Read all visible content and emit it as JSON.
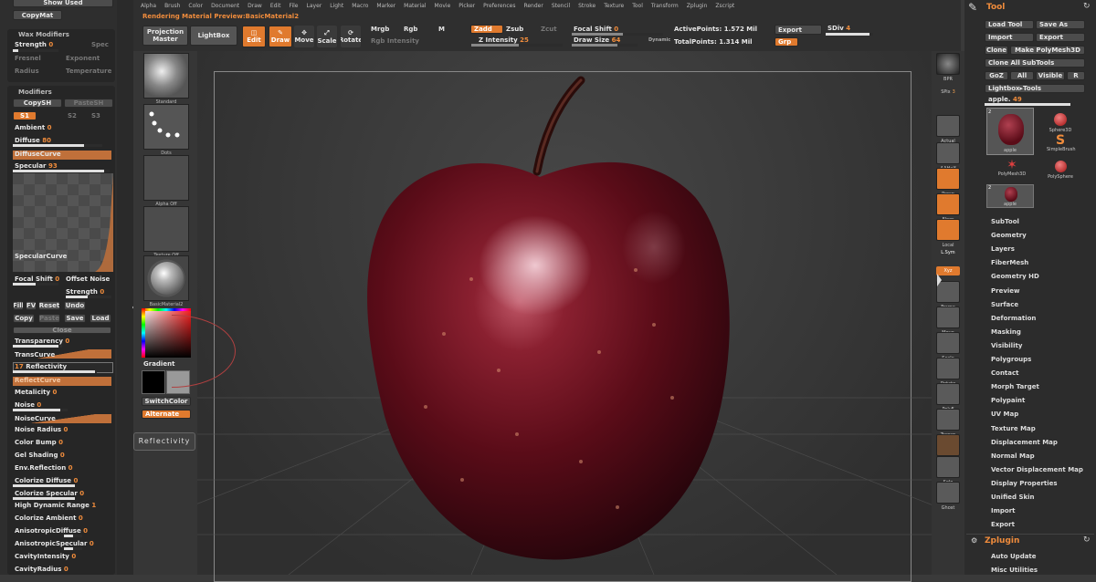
{
  "menu": [
    "Alpha",
    "Brush",
    "Color",
    "Document",
    "Draw",
    "Edit",
    "File",
    "Layer",
    "Light",
    "Macro",
    "Marker",
    "Material",
    "Movie",
    "Picker",
    "Preferences",
    "Render",
    "Stencil",
    "Stroke",
    "Texture",
    "Tool",
    "Transform",
    "Zplugin",
    "Zscript"
  ],
  "status": "Rendering Material Preview:BasicMaterial2",
  "top": {
    "projection_master": "Projection Master",
    "lightbox": "LightBox",
    "edit": "Edit",
    "draw": "Draw",
    "move": "Move",
    "scale": "Scale",
    "rotate": "Rotate",
    "mrgb": "Mrgb",
    "rgb": "Rgb",
    "m": "M",
    "rgb_intensity": "Rgb Intensity",
    "zadd": "Zadd",
    "zsub": "Zsub",
    "zcut": "Zcut",
    "z_intensity": "Z Intensity",
    "z_intensity_val": "25",
    "focal_shift": "Focal Shift",
    "focal_shift_val": "0",
    "draw_size": "Draw Size",
    "draw_size_val": "64",
    "dynamic": "Dynamic",
    "active_points": "ActivePoints: 1.572 Mil",
    "total_points": "TotalPoints: 1.314 Mil",
    "export": "Export",
    "sdiv": "SDiv",
    "sdiv_val": "4",
    "grp": "Grp"
  },
  "left": {
    "show_used": "Show Used",
    "copy_mat": "CopyMat",
    "wax_title": "Wax Modifiers",
    "wax_strength": "Strength",
    "wax_strength_val": "0",
    "wax_spec": "Spec",
    "wax_exponent": "Exponent",
    "wax_fresnel": "Fresnel",
    "wax_radius": "Radius",
    "wax_temperature": "Temperature",
    "modifiers_title": "Modifiers",
    "copy_sh": "CopySH",
    "paste_sh": "PasteSH",
    "s1": "S1",
    "s2": "S2",
    "s3": "S3",
    "ambient": "Ambient",
    "ambient_val": "0",
    "diffuse": "Diffuse",
    "diffuse_val": "80",
    "diffuse_curve": "DiffuseCurve",
    "specular": "Specular",
    "specular_val": "93",
    "specular_curve": "SpecularCurve",
    "focal_shift": "Focal Shift",
    "focal_shift_val": "0",
    "offset_noise": "Offset Noise",
    "strength": "Strength",
    "strength_val": "0",
    "fill": "Fill",
    "fv": "FV",
    "reset": "Reset",
    "undo": "Undo",
    "copy": "Copy",
    "paste": "Paste",
    "save": "Save",
    "load": "Load",
    "close": "Close",
    "transparency": "Transparency",
    "transparency_val": "0",
    "trans_curve": "TransCurve",
    "reflectivity": "Reflectivity",
    "reflectivity_val": "17",
    "reflect_curve": "ReflectCurve",
    "metalicity": "Metalicity",
    "metalicity_val": "0",
    "noise": "Noise",
    "noise_val": "0",
    "noise_curve": "NoiseCurve",
    "noise_radius": "Noise Radius",
    "noise_radius_val": "0",
    "color_bump": "Color Bump",
    "color_bump_val": "0",
    "gel_shading": "Gel Shading",
    "gel_shading_val": "0",
    "env_reflection": "Env.Reflection",
    "env_reflection_val": "0",
    "colorize_diffuse": "Colorize Diffuse",
    "colorize_diffuse_val": "0",
    "colorize_specular": "Colorize Specular",
    "colorize_specular_val": "0",
    "hdr": "High Dynamic Range",
    "hdr_val": "1",
    "colorize_ambient": "Colorize Ambient",
    "colorize_ambient_val": "0",
    "aniso_diffuse": "AnisotropicDiffuse",
    "aniso_diffuse_val": "0",
    "aniso_specular": "AnisotropicSpecular",
    "aniso_specular_val": "0",
    "cavity_intensity": "CavityIntensity",
    "cavity_intensity_val": "0",
    "cavity_radius": "CavityRadius",
    "cavity_radius_val": "0"
  },
  "shelf": {
    "standard": "Standard",
    "dots": "Dots",
    "alpha_off": "Alpha Off",
    "texture_off": "Texture Off",
    "basic_material": "BasicMaterial2",
    "gradient": "Gradient",
    "switch_color": "SwitchColor",
    "alternate": "Alternate",
    "tooltip": "Reflectivity"
  },
  "rshelf": [
    "BPR",
    "SPix",
    "Actual",
    "AAHalf",
    "Persp",
    "Floor",
    "Local",
    "L.Sym",
    "Xyz",
    "Frame",
    "Move",
    "Scale",
    "Rotate",
    "PolyF",
    "Transp",
    "Dynamic",
    "Solo",
    "Ghost"
  ],
  "rshelf_spix_val": "3",
  "right": {
    "title": "Tool",
    "load_tool": "Load Tool",
    "save_as": "Save As",
    "import": "Import",
    "export": "Export",
    "clone": "Clone",
    "make_polymesh": "Make PolyMesh3D",
    "clone_all": "Clone All SubTools",
    "goz": "GoZ",
    "all": "All",
    "visible": "Visible",
    "r": "R",
    "lightbox_tools": "Lightbox▸Tools",
    "apple_label": "apple.",
    "apple_val": "49",
    "thumb_count": "2",
    "thumbs": [
      "apple",
      "Sphere3D",
      "SimpleBrush",
      "PolyMesh3D",
      "PolySphere",
      "apple"
    ],
    "items": [
      "SubTool",
      "Geometry",
      "Layers",
      "FiberMesh",
      "Geometry HD",
      "Preview",
      "Surface",
      "Deformation",
      "Masking",
      "Visibility",
      "Polygroups",
      "Contact",
      "Morph Target",
      "Polypaint",
      "UV Map",
      "Texture Map",
      "Displacement Map",
      "Normal Map",
      "Vector Displacement Map",
      "Display Properties",
      "Unified Skin",
      "Import",
      "Export"
    ],
    "zplugin": "Zplugin",
    "auto_update": "Auto Update",
    "misc": "Misc Utilities"
  },
  "colors": {
    "accent": "#e07a2e",
    "bg": "#3a3a3a",
    "apple": "#7a1020"
  }
}
